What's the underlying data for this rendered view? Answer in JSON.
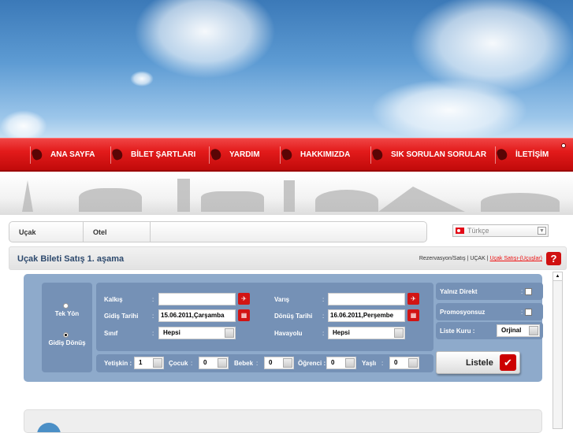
{
  "nav": {
    "items": [
      {
        "label": "ANA SAYFA",
        "icon": "home-icon"
      },
      {
        "label": "BİLET ŞARTLARI",
        "icon": "ticket-icon"
      },
      {
        "label": "YARDIM",
        "icon": "help-icon"
      },
      {
        "label": "HAKKIMIZDA",
        "icon": "about-icon"
      },
      {
        "label": "SIK SORULAN SORULAR",
        "icon": "faq-icon"
      },
      {
        "label": "İLETİŞİM",
        "icon": "contact-icon"
      }
    ]
  },
  "tabs": [
    {
      "label": "Uçak"
    },
    {
      "label": "Otel"
    }
  ],
  "language": {
    "selected": "Türkçe"
  },
  "page": {
    "title": "Uçak Bileti Satış 1. aşama",
    "crumb_plain": "Rezervasyon/Satış | UÇAK | ",
    "crumb_link": "Uçak Satışı-(Uçuşlar)",
    "help": "?"
  },
  "form": {
    "trip": {
      "one_way": "Tek Yön",
      "round_trip": "Gidiş Dönüş",
      "selected": "round_trip"
    },
    "from_label": "Kalkış",
    "from_value": "",
    "to_label": "Varış",
    "to_value": "",
    "depart_label": "Gidiş Tarihi",
    "depart_value": "15.06.2011,Çarşamba",
    "return_label": "Dönüş Tarihi",
    "return_value": "16.06.2011,Perşembe",
    "class_label": "Sınıf",
    "class_value": "Hepsi",
    "airline_label": "Havayolu",
    "airline_value": "Hepsi",
    "colon": ":",
    "direct_label": "Yalnız Direkt",
    "direct_checked": false,
    "promo_label": "Promosyonsuz",
    "promo_checked": false,
    "currency_label": "Liste Kuru :",
    "currency_value": "Orjinal",
    "pax": [
      {
        "label": "Yetişkin :",
        "value": "1"
      },
      {
        "label": "Çocuk",
        "value": "0"
      },
      {
        "label": "Bebek",
        "value": "0"
      },
      {
        "label": "Öğrenci :",
        "value": "0"
      },
      {
        "label": "Yaşlı",
        "value": "0"
      }
    ],
    "submit": "Listele"
  }
}
